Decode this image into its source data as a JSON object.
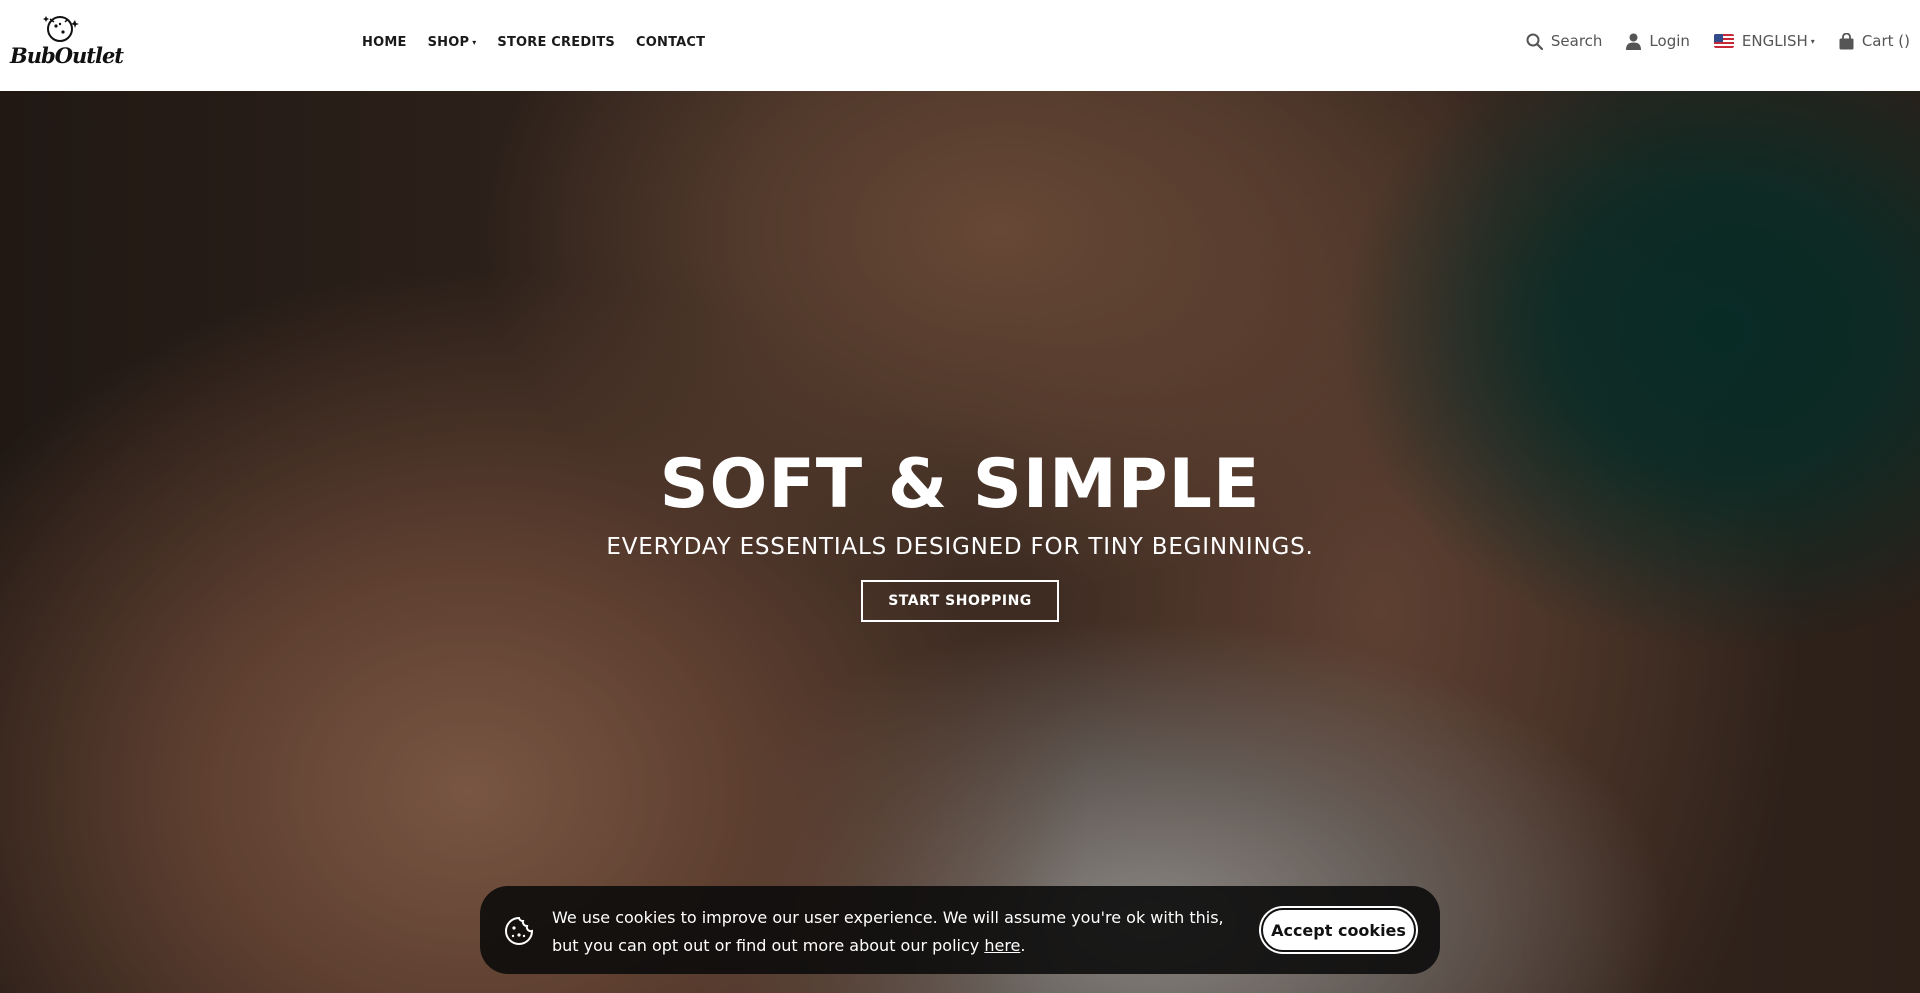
{
  "brand": {
    "name": "BubOutlet"
  },
  "nav": {
    "items": [
      {
        "label": "HOME"
      },
      {
        "label": "SHOP",
        "has_dropdown": true
      },
      {
        "label": "STORE CREDITS"
      },
      {
        "label": "CONTACT"
      }
    ],
    "caret_glyph": "▾"
  },
  "utils": {
    "search_label": "Search",
    "login_label": "Login",
    "language_label": "ENGLISH",
    "cart_label": "Cart ()"
  },
  "hero": {
    "title": "SOFT & SIMPLE",
    "subtitle": "EVERYDAY ESSENTIALS DESIGNED FOR TINY BEGINNINGS.",
    "cta_label": "START SHOPPING"
  },
  "cookie": {
    "text_before": "We use cookies to improve our user experience. We will assume you're ok with this, but you can opt out or find out more about our policy ",
    "link_label": "here",
    "text_after": ".",
    "button_label": "Accept cookies"
  },
  "colors": {
    "header_bg": "#ffffff",
    "nav_text": "#1a1a1a",
    "util_text": "#555555",
    "hero_text": "#ffffff",
    "cookie_bg": "#0a0a0a",
    "cookie_button_bg": "#ffffff"
  },
  "icons": {
    "logo": "cookie-baby-logo",
    "search": "search-icon",
    "login": "user-icon",
    "language": "us-flag-icon",
    "cart": "shopping-bag-icon",
    "cookie": "cookie-icon"
  }
}
